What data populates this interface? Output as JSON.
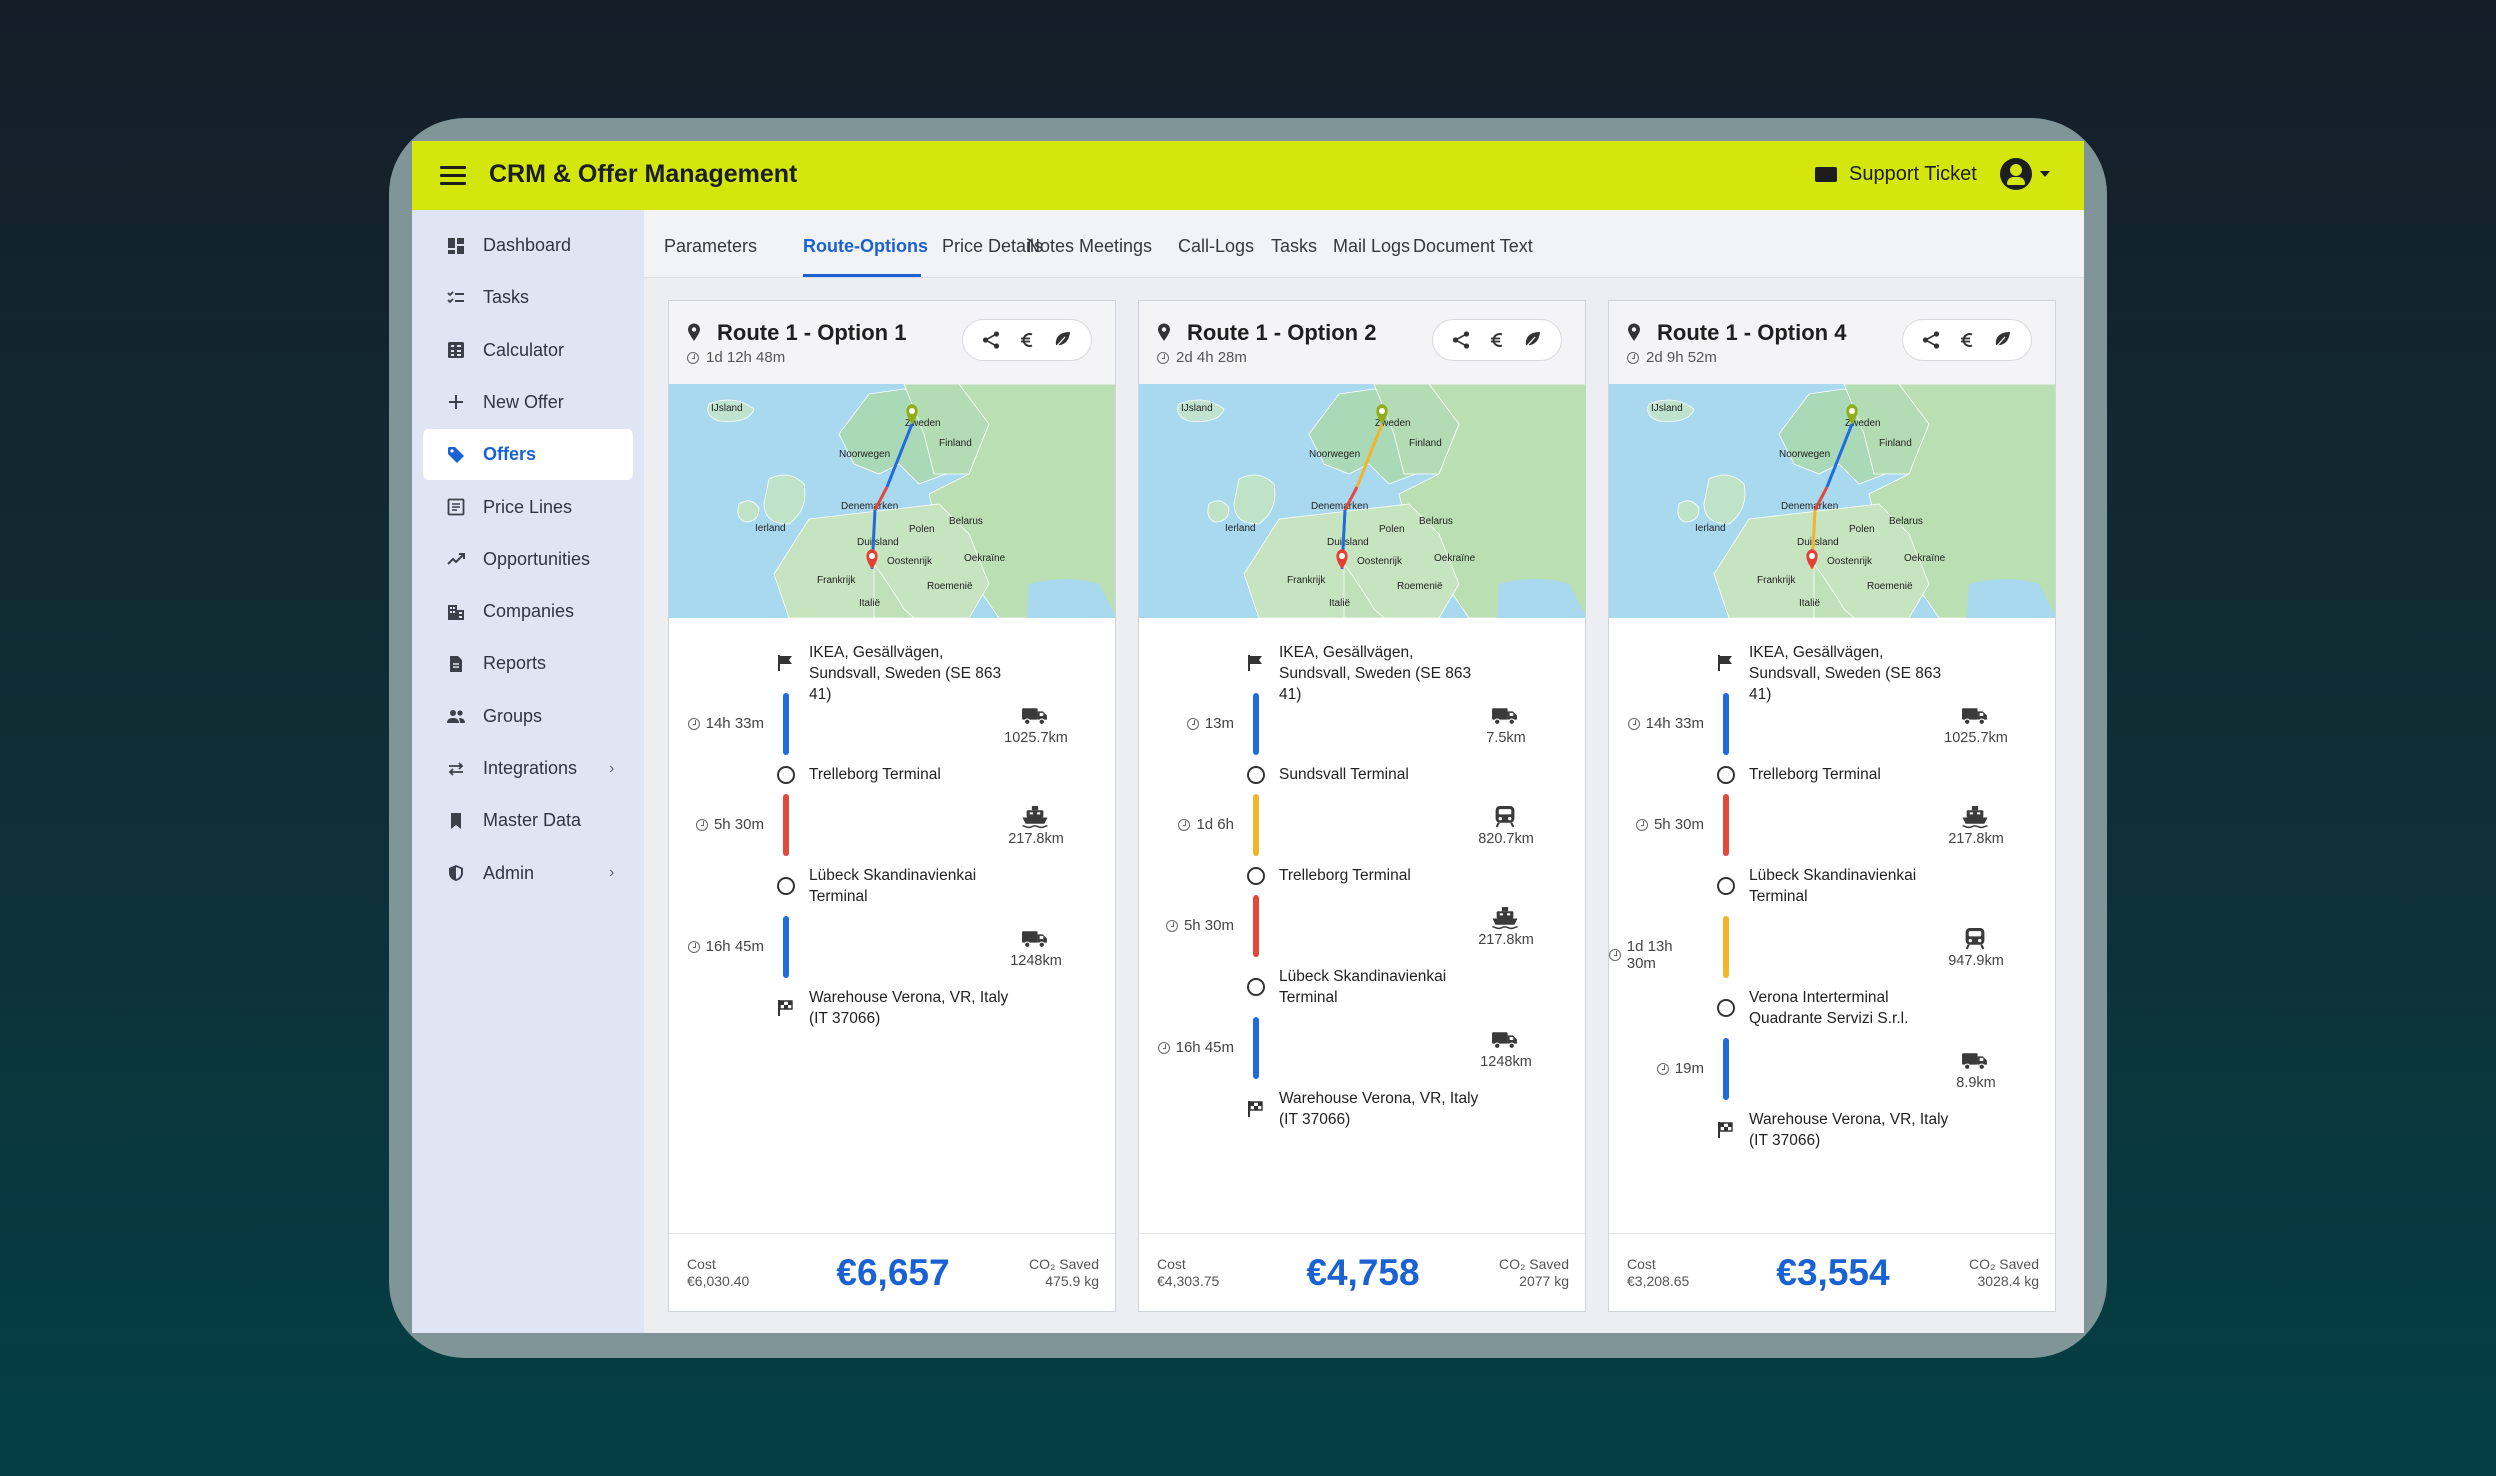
{
  "app": {
    "title": "CRM & Offer Management",
    "support_label": "Support Ticket"
  },
  "colors": {
    "accent": "#d4e70c",
    "primary": "#1a62d2",
    "road": "#1f6be0",
    "sea": "#e3493b",
    "rail": "#f2b52a"
  },
  "sidebar": {
    "items": [
      {
        "label": "Dashboard",
        "icon": "dashboard-icon"
      },
      {
        "label": "Tasks",
        "icon": "checklist-icon"
      },
      {
        "label": "Calculator",
        "icon": "calculator-icon"
      },
      {
        "label": "New Offer",
        "icon": "plus-icon"
      },
      {
        "label": "Offers",
        "icon": "tag-icon",
        "active": true
      },
      {
        "label": "Price Lines",
        "icon": "list-icon"
      },
      {
        "label": "Opportunities",
        "icon": "trending-icon"
      },
      {
        "label": "Companies",
        "icon": "building-icon"
      },
      {
        "label": "Reports",
        "icon": "document-icon"
      },
      {
        "label": "Groups",
        "icon": "people-icon"
      },
      {
        "label": "Integrations",
        "icon": "swap-icon",
        "chevron": "›"
      },
      {
        "label": "Master Data",
        "icon": "bookmark-icon"
      },
      {
        "label": "Admin",
        "icon": "shield-icon",
        "chevron": "›"
      }
    ]
  },
  "tabs": [
    "Parameters",
    "Route-Options",
    "Price Details",
    "Notes",
    "Meetings",
    "Call-Logs",
    "Tasks",
    "Mail Logs",
    "Document Text"
  ],
  "active_tab": "Route-Options",
  "map_labels": {
    "ijsland": "IJsland",
    "noorwegen": "Noorwegen",
    "finland": "Finland",
    "zweden": "Zweden",
    "denemarken": "Denemarken",
    "ierland": "Ierland",
    "polen": "Polen",
    "belarus": "Belarus",
    "duitsland": "Duitsland",
    "oekraine": "Oekraïne",
    "frankrijk": "Frankrijk",
    "oostenrijk": "Oostenrijk",
    "italie": "Italië",
    "roemenie": "Roemenië"
  },
  "routes": [
    {
      "title": "Route 1 - Option 1",
      "duration": "1d 12h 48m",
      "stops": [
        "IKEA, Gesällvägen, Sundsvall, Sweden (SE 863 41)",
        "Trelleborg Terminal",
        "Lübeck Skandinavienkai Terminal",
        "Warehouse Verona, VR, Italy (IT 37066)"
      ],
      "segments": [
        {
          "time": "14h 33m",
          "mode": "truck",
          "distance": "1025.7km"
        },
        {
          "time": "5h 30m",
          "mode": "ship",
          "distance": "217.8km"
        },
        {
          "time": "16h 45m",
          "mode": "truck",
          "distance": "1248km"
        }
      ],
      "cost_label": "Cost",
      "cost": "€6,030.40",
      "price": "€6,657",
      "co2_label": "CO₂ Saved",
      "co2": "475.9 kg"
    },
    {
      "title": "Route 1 - Option 2",
      "duration": "2d 4h 28m",
      "stops": [
        "IKEA, Gesällvägen, Sundsvall, Sweden (SE 863 41)",
        "Sundsvall Terminal",
        "Trelleborg Terminal",
        "Lübeck Skandinavienkai Terminal",
        "Warehouse Verona, VR, Italy (IT 37066)"
      ],
      "segments": [
        {
          "time": "13m",
          "mode": "truck",
          "distance": "7.5km"
        },
        {
          "time": "1d 6h",
          "mode": "train",
          "distance": "820.7km"
        },
        {
          "time": "5h 30m",
          "mode": "ship",
          "distance": "217.8km"
        },
        {
          "time": "16h 45m",
          "mode": "truck",
          "distance": "1248km"
        }
      ],
      "cost_label": "Cost",
      "cost": "€4,303.75",
      "price": "€4,758",
      "co2_label": "CO₂ Saved",
      "co2": "2077 kg"
    },
    {
      "title": "Route 1 - Option 4",
      "duration": "2d 9h 52m",
      "stops": [
        "IKEA, Gesällvägen, Sundsvall, Sweden (SE 863 41)",
        "Trelleborg Terminal",
        "Lübeck Skandinavienkai Terminal",
        "Verona Interterminal Quadrante Servizi S.r.l.",
        "Warehouse Verona, VR, Italy (IT 37066)"
      ],
      "segments": [
        {
          "time": "14h 33m",
          "mode": "truck",
          "distance": "1025.7km"
        },
        {
          "time": "5h 30m",
          "mode": "ship",
          "distance": "217.8km"
        },
        {
          "time": "1d 13h 30m",
          "mode": "train",
          "distance": "947.9km"
        },
        {
          "time": "19m",
          "mode": "truck",
          "distance": "8.9km"
        }
      ],
      "cost_label": "Cost",
      "cost": "€3,208.65",
      "price": "€3,554",
      "co2_label": "CO₂ Saved",
      "co2": "3028.4 kg"
    }
  ]
}
